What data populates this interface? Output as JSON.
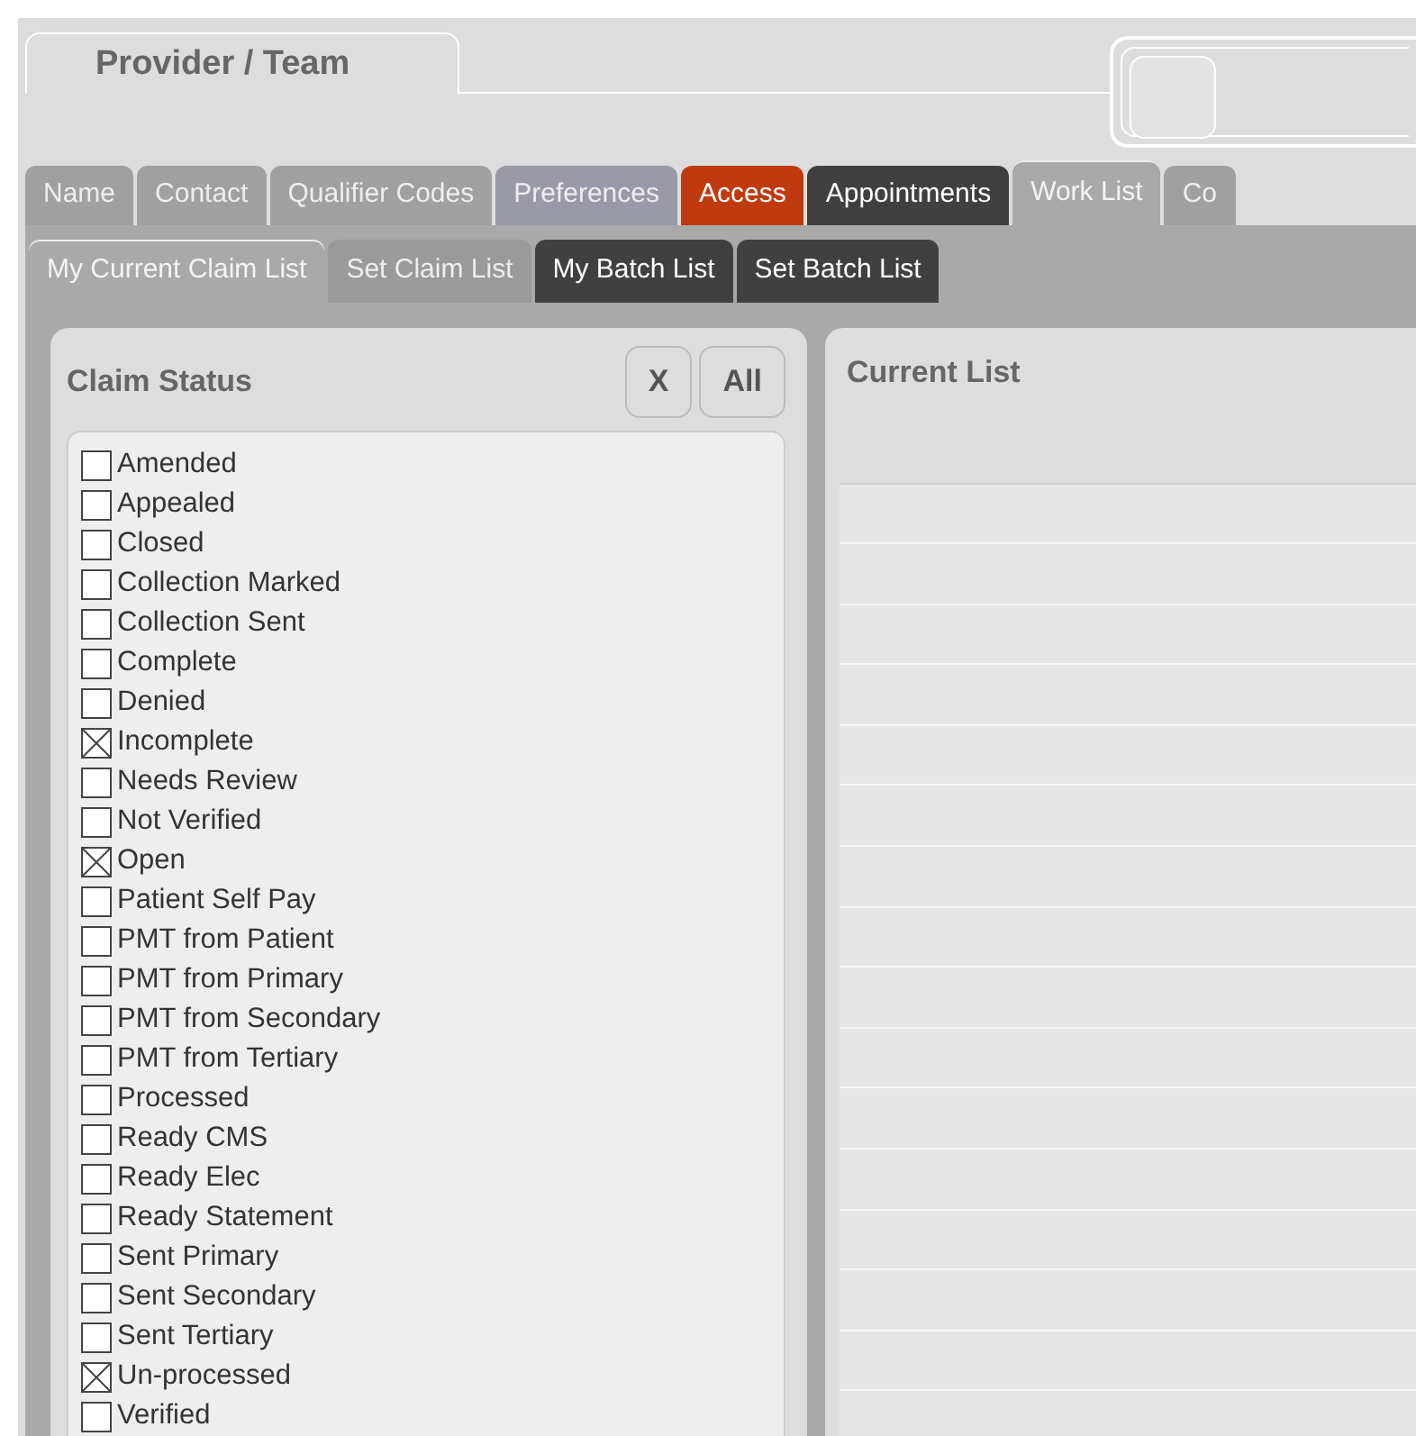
{
  "header_tab": {
    "label": "Provider / Team"
  },
  "tabs": [
    {
      "label": "Name",
      "selected": false,
      "color": "#a0a0a0"
    },
    {
      "label": "Contact",
      "selected": false,
      "color": "#a0a0a0"
    },
    {
      "label": "Qualifier Codes",
      "selected": false,
      "color": "#a0a0a0"
    },
    {
      "label": "Preferences",
      "selected": false,
      "color": "#9a99a8"
    },
    {
      "label": "Access",
      "selected": false,
      "color": "#c03a10"
    },
    {
      "label": "Appointments",
      "selected": false,
      "color": "#404040"
    },
    {
      "label": "Work List",
      "selected": true,
      "color": "#a9a9a9"
    },
    {
      "label": "Co",
      "selected": false,
      "color": "#a0a0a0"
    }
  ],
  "sub_tabs": [
    {
      "label": "My Current Claim List",
      "selected": true,
      "color": "#a9a9a9"
    },
    {
      "label": "Set Claim List",
      "selected": false,
      "color": "#9a9a9a"
    },
    {
      "label": "My Batch List",
      "selected": false,
      "color": "#404040"
    },
    {
      "label": "Set Batch List",
      "selected": false,
      "color": "#404040"
    }
  ],
  "claim_status": {
    "title": "Claim Status",
    "buttons": [
      "X",
      "All"
    ],
    "items": [
      {
        "label": "Amended",
        "checked": false
      },
      {
        "label": "Appealed",
        "checked": false
      },
      {
        "label": "Closed",
        "checked": false
      },
      {
        "label": "Collection Marked",
        "checked": false
      },
      {
        "label": "Collection Sent",
        "checked": false
      },
      {
        "label": "Complete",
        "checked": false
      },
      {
        "label": "Denied",
        "checked": false
      },
      {
        "label": "Incomplete",
        "checked": true
      },
      {
        "label": "Needs Review",
        "checked": false
      },
      {
        "label": "Not Verified",
        "checked": false
      },
      {
        "label": "Open",
        "checked": true
      },
      {
        "label": "Patient Self Pay",
        "checked": false
      },
      {
        "label": "PMT from Patient",
        "checked": false
      },
      {
        "label": "PMT from Primary",
        "checked": false
      },
      {
        "label": "PMT from Secondary",
        "checked": false
      },
      {
        "label": "PMT from Tertiary",
        "checked": false
      },
      {
        "label": "Processed",
        "checked": false
      },
      {
        "label": "Ready CMS",
        "checked": false
      },
      {
        "label": "Ready Elec",
        "checked": false
      },
      {
        "label": "Ready Statement",
        "checked": false
      },
      {
        "label": "Sent Primary",
        "checked": false
      },
      {
        "label": "Sent Secondary",
        "checked": false
      },
      {
        "label": "Sent Tertiary",
        "checked": false
      },
      {
        "label": "Un-processed",
        "checked": true
      },
      {
        "label": "Verified",
        "checked": false
      }
    ]
  },
  "current_list": {
    "title": "Current List"
  }
}
